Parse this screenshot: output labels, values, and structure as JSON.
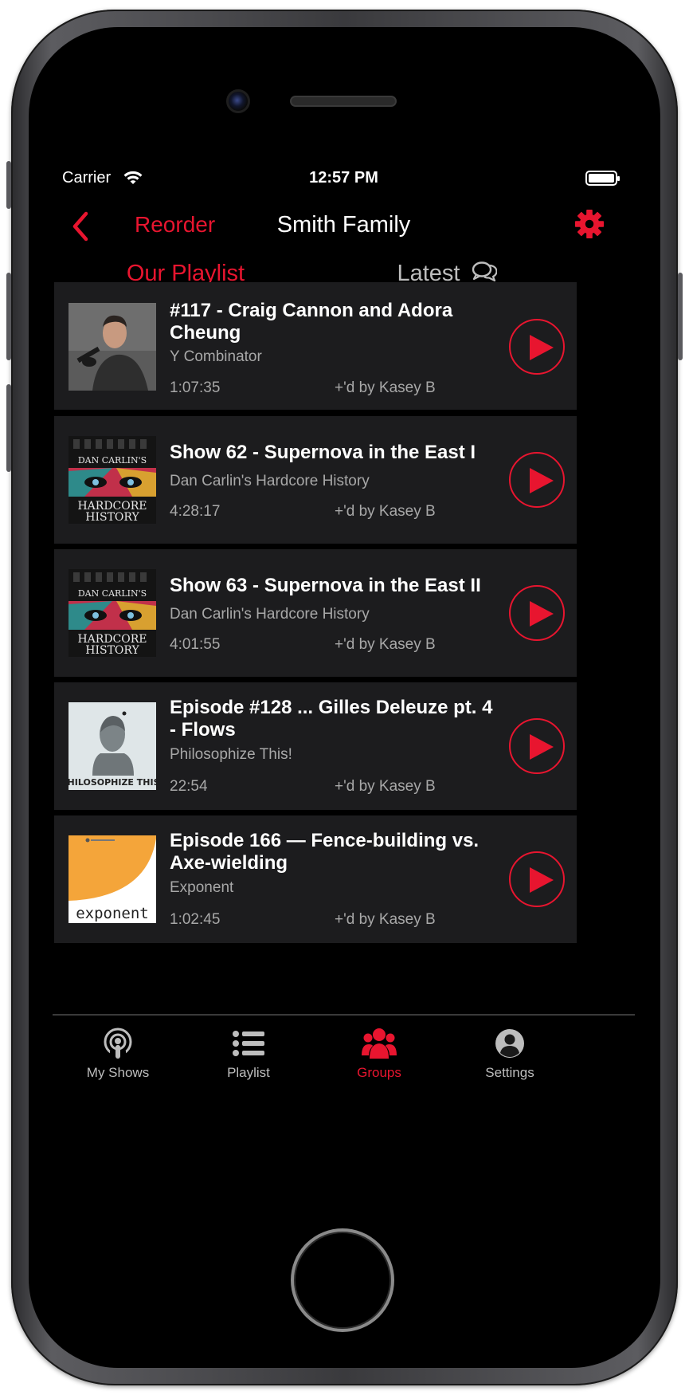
{
  "status_bar": {
    "carrier": "Carrier",
    "time": "12:57 PM"
  },
  "nav": {
    "back_icon": "chevron-left-icon",
    "reorder_label": "Reorder",
    "title": "Smith Family",
    "settings_icon": "gear-icon"
  },
  "tabs": [
    {
      "label": "Our Playlist",
      "selected": true
    },
    {
      "label": "Latest",
      "icon": "chat-bubbles-icon",
      "selected": false
    }
  ],
  "episodes": [
    {
      "title": "#117 - Craig Cannon and Adora Cheung",
      "show": "Y Combinator",
      "duration": "1:07:35",
      "added_by": "+'d by Kasey B",
      "artwork": "Y Combinator podcast artwork"
    },
    {
      "title": "Show 62 - Supernova in the East I",
      "show": "Dan Carlin's Hardcore History",
      "duration": "4:28:17",
      "added_by": "+'d by Kasey B",
      "artwork": "Hardcore History artwork",
      "art_caption_top": "DAN CARLIN'S",
      "art_caption_bottom": "HARDCORE HISTORY"
    },
    {
      "title": "Show 63 - Supernova in the East II",
      "show": "Dan Carlin's Hardcore History",
      "duration": "4:01:55",
      "added_by": "+'d by Kasey B",
      "artwork": "Hardcore History artwork",
      "art_caption_top": "DAN CARLIN'S",
      "art_caption_bottom": "HARDCORE HISTORY"
    },
    {
      "title": "Episode #128 ... Gilles Deleuze pt. 4 - Flows",
      "show": "Philosophize This!",
      "duration": "22:54",
      "added_by": "+'d by Kasey B",
      "artwork": "Philosophize This! artwork",
      "art_caption_bottom": "PHILOSOPHIZE THIS!"
    },
    {
      "title": "Episode 166 — Fence-building vs. Axe-wielding",
      "show": "Exponent",
      "duration": "1:02:45",
      "added_by": "+'d by Kasey B",
      "artwork": "Exponent artwork",
      "art_caption_bottom": "exponent"
    }
  ],
  "tab_bar": [
    {
      "label": "My Shows",
      "icon": "podcast-icon",
      "active": false
    },
    {
      "label": "Playlist",
      "icon": "list-icon",
      "active": false
    },
    {
      "label": "Groups",
      "icon": "group-icon",
      "active": true
    },
    {
      "label": "Settings",
      "icon": "user-circle-icon",
      "active": false
    }
  ],
  "colors": {
    "accent": "#e8152f",
    "background": "#000000",
    "row_background": "#1c1c1e",
    "secondary_text": "#a8a8a8"
  }
}
